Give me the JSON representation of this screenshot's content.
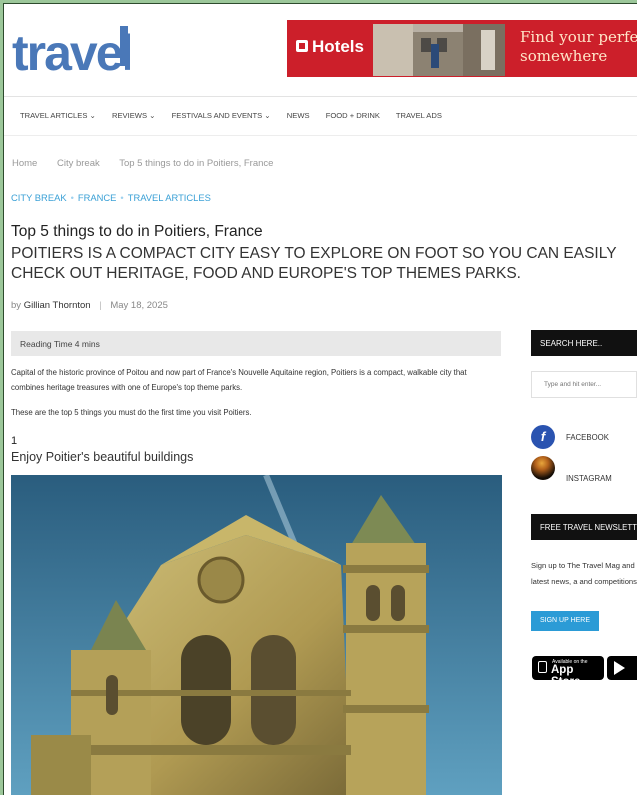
{
  "header": {
    "logo_text": "travel",
    "ad": {
      "brand": "Hotels",
      "tagline_line1": "Find your perfe",
      "tagline_line2": "somewhere"
    }
  },
  "nav": {
    "items": [
      {
        "label": "TRAVEL ARTICLES ⌄"
      },
      {
        "label": "REVIEWS ⌄"
      },
      {
        "label": "FESTIVALS AND EVENTS ⌄"
      },
      {
        "label": "NEWS"
      },
      {
        "label": "FOOD + DRINK"
      },
      {
        "label": "TRAVEL ADS"
      }
    ]
  },
  "breadcrumb": {
    "items": [
      "Home",
      "City break",
      "Top 5 things to do in Poitiers, France"
    ]
  },
  "categories": [
    "CITY BREAK",
    "FRANCE",
    "TRAVEL ARTICLES"
  ],
  "article": {
    "title": "Top 5 things to do in Poitiers, France",
    "subtitle": "POITIERS IS A COMPACT CITY EASY TO EXPLORE ON FOOT SO YOU CAN EASILY CHECK OUT HERITAGE, FOOD AND EUROPE'S TOP THEMES PARKS.",
    "byline_prefix": "by",
    "author": "Gillian Thornton",
    "date": "May 18, 2025",
    "reading_time": "Reading Time 4 mins",
    "para1": "Capital of the historic province of Poitou and now part of France's Nouvelle Aquitaine region, Poitiers is a compact, walkable city that combines heritage treasures with one of Europe's top theme parks.",
    "para2": "These are the top 5 things you must do the first time you visit Poitiers.",
    "section_number": "1",
    "section_title": "Enjoy Poitier's beautiful buildings"
  },
  "sidebar": {
    "search_title": "SEARCH HERE..",
    "search_placeholder": "Type and hit enter...",
    "facebook_label": "FACEBOOK",
    "instagram_label": "INSTAGRAM",
    "newsletter_title": "FREE TRAVEL NEWSLETT",
    "signup_text": "Sign up to The Travel Mag and get the latest news, a and competitions.",
    "signup_button": "SIGN UP HERE",
    "appstore_small": "Available on the",
    "appstore_big": "App Store"
  },
  "colors": {
    "accent_blue": "#3aa0d6",
    "ad_red": "#cc1f2a",
    "logo_blue": "#4a78b8",
    "facebook": "#2a53b0"
  },
  "icons": [
    "facebook-icon",
    "instagram-icon",
    "apple-icon",
    "google-play-icon"
  ]
}
